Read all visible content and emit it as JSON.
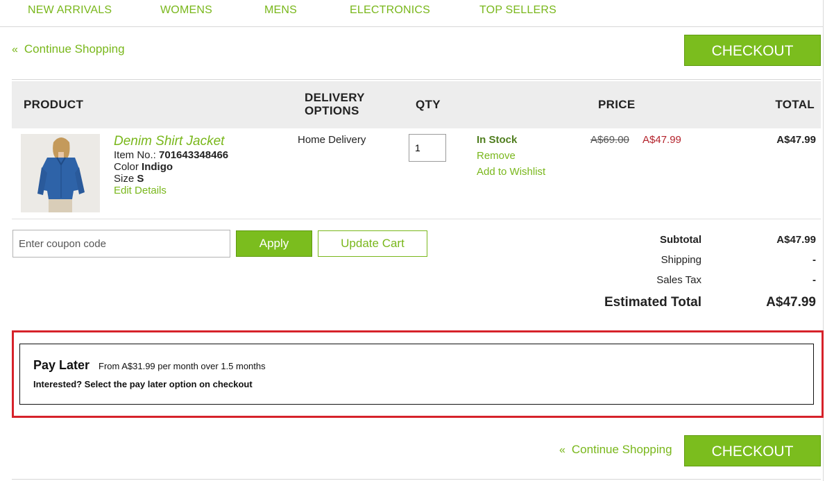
{
  "nav": {
    "items": [
      "NEW ARRIVALS",
      "WOMENS",
      "MENS",
      "ELECTRONICS",
      "TOP SELLERS"
    ]
  },
  "actions": {
    "continue_chevron": "«",
    "continue_label": "Continue Shopping",
    "checkout_label": "CHECKOUT"
  },
  "table": {
    "headers": {
      "product": "PRODUCT",
      "delivery_line1": "DELIVERY",
      "delivery_line2": "OPTIONS",
      "qty": "QTY",
      "price": "PRICE",
      "total": "TOTAL"
    }
  },
  "item": {
    "image_icon": "product-photo-icon",
    "name": "Denim Shirt Jacket",
    "item_no_label": "Item No.:",
    "item_no": "701643348466",
    "color_label": "Color",
    "color": "Indigo",
    "size_label": "Size",
    "size": "S",
    "edit_label": "Edit Details",
    "delivery": "Home Delivery",
    "qty": "1",
    "stock": "In Stock",
    "remove_label": "Remove",
    "wishlist_label": "Add to Wishlist",
    "old_price": "A$69.00",
    "new_price": "A$47.99",
    "total": "A$47.99"
  },
  "coupon": {
    "placeholder": "Enter coupon code",
    "apply_label": "Apply",
    "update_label": "Update Cart"
  },
  "summary": {
    "subtotal_label": "Subtotal",
    "subtotal": "A$47.99",
    "shipping_label": "Shipping",
    "shipping": "-",
    "tax_label": "Sales Tax",
    "tax": "-",
    "estimated_label": "Estimated Total",
    "estimated": "A$47.99"
  },
  "pay_later": {
    "title": "Pay Later",
    "subtitle": "From A$31.99 per month over 1.5 months",
    "note": "Interested? Select the pay later option on checkout"
  },
  "colors": {
    "accent": "#79b71b",
    "button": "#7bbd1e",
    "sale": "#b4232c",
    "highlight": "#d6222a"
  }
}
